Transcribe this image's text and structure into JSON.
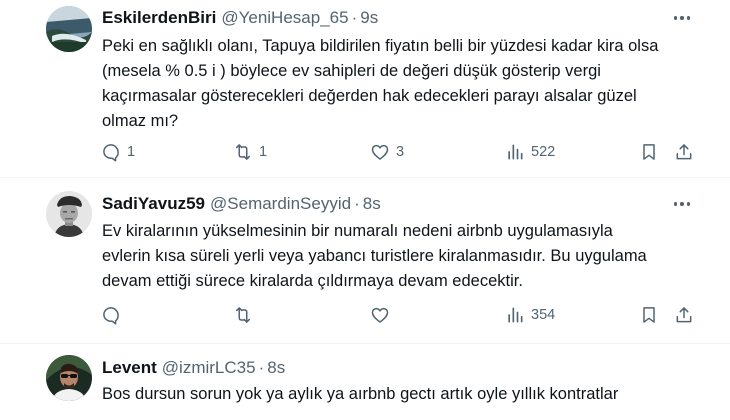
{
  "tweets": [
    {
      "name": "EskilerdenBiri",
      "handle": "@YeniHesap_65",
      "time": "9s",
      "avatar": "landscape-avatar",
      "lines": [
        "Peki en sağlıklı olanı, Tapuya bildirilen fiyatın belli bir yüzdesi kadar kira olsa",
        "(mesela % 0.5 i ) böylece ev sahipleri de değeri düşük gösterip vergi",
        "kaçırmasalar gösterecekleri değerden hak edecekleri parayı alsalar güzel",
        "olmaz mı?"
      ],
      "replies": "1",
      "retweets": "1",
      "likes": "3",
      "views": "522"
    },
    {
      "name": "SadiYavuz59",
      "handle": "@SemardinSeyyid",
      "time": "8s",
      "avatar": "soldier-avatar",
      "lines": [
        "Ev kiralarının yükselmesinin bir numaralı nedeni airbnb uygulamasıyla",
        "evlerin kısa süreli yerli veya yabancı turistlere kiralanmasıdır. Bu uygulama",
        "devam ettiği sürece kiralarda çıldırmaya devam edecektir."
      ],
      "replies": "",
      "retweets": "",
      "likes": "",
      "views": "354"
    },
    {
      "name": "Levent",
      "handle": "@izmirLC35",
      "time": "8s",
      "avatar": "man-avatar",
      "lines": [
        "Bos dursun sorun yok ya aylık ya aırbnb gectı artık oyle yıllık kontratlar"
      ]
    }
  ],
  "separator": "·"
}
